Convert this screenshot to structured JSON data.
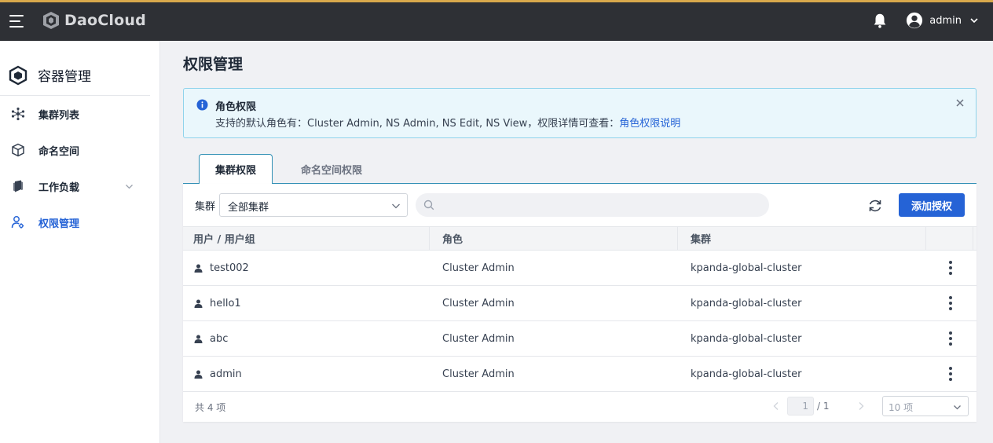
{
  "header": {
    "brand": "DaoCloud",
    "user": "admin"
  },
  "sidebar": {
    "title": "容器管理",
    "items": [
      {
        "label": "集群列表",
        "icon": "cluster-icon"
      },
      {
        "label": "命名空间",
        "icon": "cube-icon"
      },
      {
        "label": "工作负载",
        "icon": "workload-icon"
      },
      {
        "label": "权限管理",
        "icon": "user-permission-icon"
      }
    ]
  },
  "main": {
    "title": "权限管理",
    "alert": {
      "title": "角色权限",
      "desc_prefix": "支持的默认角色有：Cluster Admin, NS Admin, NS Edit, NS View，权限详情可查看：",
      "link": "角色权限说明"
    },
    "tabs": [
      "集群权限",
      "命名空间权限"
    ],
    "filter": {
      "label": "集群",
      "value": "全部集群",
      "search_placeholder": ""
    },
    "add_button": "添加授权",
    "table": {
      "columns": [
        "用户 / 用户组",
        "角色",
        "集群"
      ],
      "rows": [
        {
          "user": "test002",
          "role": "Cluster Admin",
          "cluster": "kpanda-global-cluster"
        },
        {
          "user": "hello1",
          "role": "Cluster Admin",
          "cluster": "kpanda-global-cluster"
        },
        {
          "user": "abc",
          "role": "Cluster Admin",
          "cluster": "kpanda-global-cluster"
        },
        {
          "user": "admin",
          "role": "Cluster Admin",
          "cluster": "kpanda-global-cluster"
        }
      ]
    },
    "pagination": {
      "total": "共 4 项",
      "current": "1",
      "pages": "/ 1",
      "page_size": "10 项"
    }
  },
  "colors": {
    "topbar": "#2e3035",
    "accent": "#2563d6",
    "alert_bg": "#eaf7fc"
  }
}
